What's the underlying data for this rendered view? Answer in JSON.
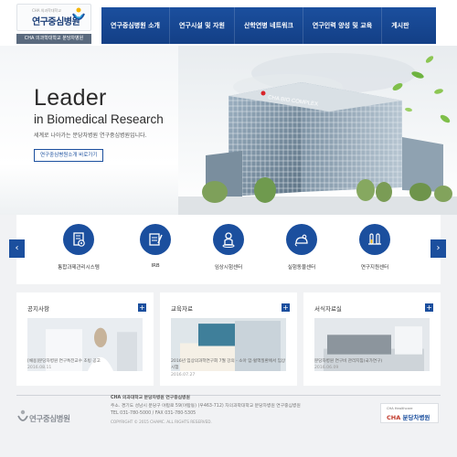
{
  "logo": {
    "small_text": "CHA 의과학대학교",
    "main_text": "연구중심병원",
    "sub_text": "CHA 의과학대학교 분당차병원"
  },
  "nav": {
    "items": [
      {
        "label": "연구중심병원 소개"
      },
      {
        "label": "연구시설 및 자원"
      },
      {
        "label": "산학연병 네트워크"
      },
      {
        "label": "연구인력 양성 및 교육"
      },
      {
        "label": "게시판"
      }
    ]
  },
  "hero": {
    "title": "Leader",
    "subtitle": "in Biomedical Research",
    "description": "세계로 나아가는 분당차병원 연구중심병원입니다.",
    "button_label": "연구중심병원소개 바로가기",
    "building_sign": "CHA BIO COMPLEX"
  },
  "carousel": {
    "prev_label": "‹",
    "next_label": "›",
    "items": [
      {
        "label": "통합과제관리시스템",
        "icon": "gear-document-icon"
      },
      {
        "label": "IRB",
        "icon": "notebook-pen-icon"
      },
      {
        "label": "임상시험센터",
        "icon": "person-pin-icon"
      },
      {
        "label": "실험동물센터",
        "icon": "mouse-icon"
      },
      {
        "label": "연구지원센터",
        "icon": "test-tubes-icon"
      }
    ]
  },
  "cards": [
    {
      "title": "공지사항",
      "plus": "+",
      "text": "[채용]분당차병원 연구특전교수 초빙 공고",
      "date": "2016.08.11"
    },
    {
      "title": "교육자료",
      "plus": "+",
      "text": "2016년 임상의과학연구회 7월 강의 - 소아 암·혈액질환에서 임상시험",
      "date": "2016.07.27"
    },
    {
      "title": "서식자료실",
      "plus": "+",
      "text": "분당차병원 연구비 관리지침(국가연구)",
      "date": "2016.06.09"
    }
  ],
  "footer": {
    "logo_text": "연구중심병원",
    "org": "CHA 의과대학교 분당차병원 연구중심병원",
    "address": "주소. 경기도 성남시 분당구 야탑로 59(야탑동) (우463-712) 차의과학대학교 분당차병원 연구중심병원",
    "phone": "TEL 031-780-5000 / FAX 031-780-5305",
    "copyright": "COPYRIGHT © 2015 CHAMC. ALL RIGHTS RESERVED.",
    "badge_small": "CHA Healthcare",
    "badge_cha": "CHA",
    "badge_main": "분당차병원"
  },
  "colors": {
    "primary": "#1b4f9e",
    "footer_gray": "#8a8f96"
  }
}
